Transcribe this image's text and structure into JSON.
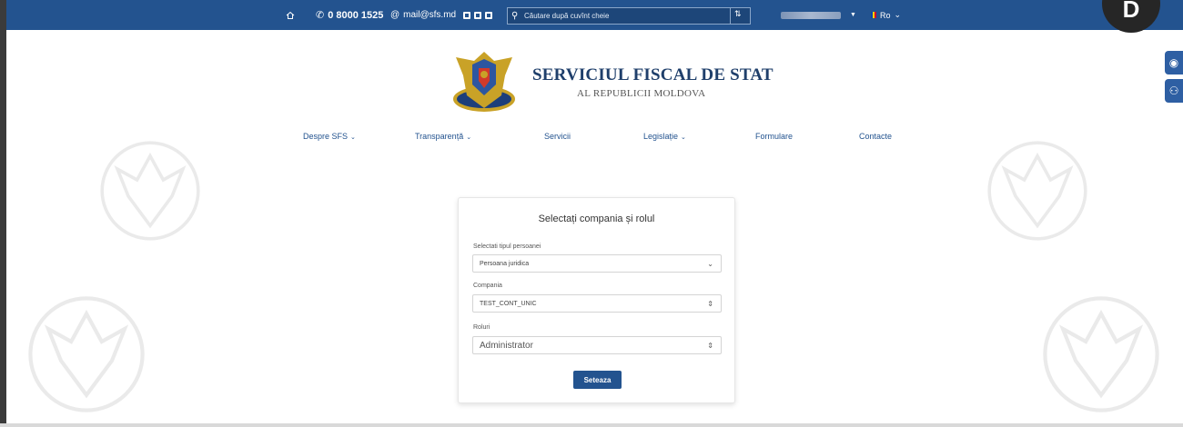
{
  "topbar": {
    "phone": "0 8000 1525",
    "email": "mail@sfs.md",
    "search_placeholder": "Căutare după cuvînt cheie",
    "language": "Ro",
    "avatar_letter": "D"
  },
  "header": {
    "title": "SERVICIUL FISCAL DE STAT",
    "subtitle": "AL REPUBLICII MOLDOVA"
  },
  "nav": {
    "items": [
      {
        "label": "Despre SFS",
        "has_dropdown": true
      },
      {
        "label": "Transparență",
        "has_dropdown": true
      },
      {
        "label": "Servicii",
        "has_dropdown": false
      },
      {
        "label": "Legislație",
        "has_dropdown": true
      },
      {
        "label": "Formulare",
        "has_dropdown": false
      },
      {
        "label": "Contacte",
        "has_dropdown": false
      }
    ]
  },
  "form": {
    "title": "Selectați compania și rolul",
    "person_type_label": "Selectati tipul persoanei",
    "person_type_value": "Persoana juridica",
    "company_label": "Compania",
    "company_value": "TEST_CONT_UNIC",
    "roles_label": "Roluri",
    "roles_value": "Administrator",
    "submit_label": "Seteaza"
  },
  "colors": {
    "topbar": "#23538f",
    "accent": "#23538f",
    "title": "#1f3f6b"
  }
}
